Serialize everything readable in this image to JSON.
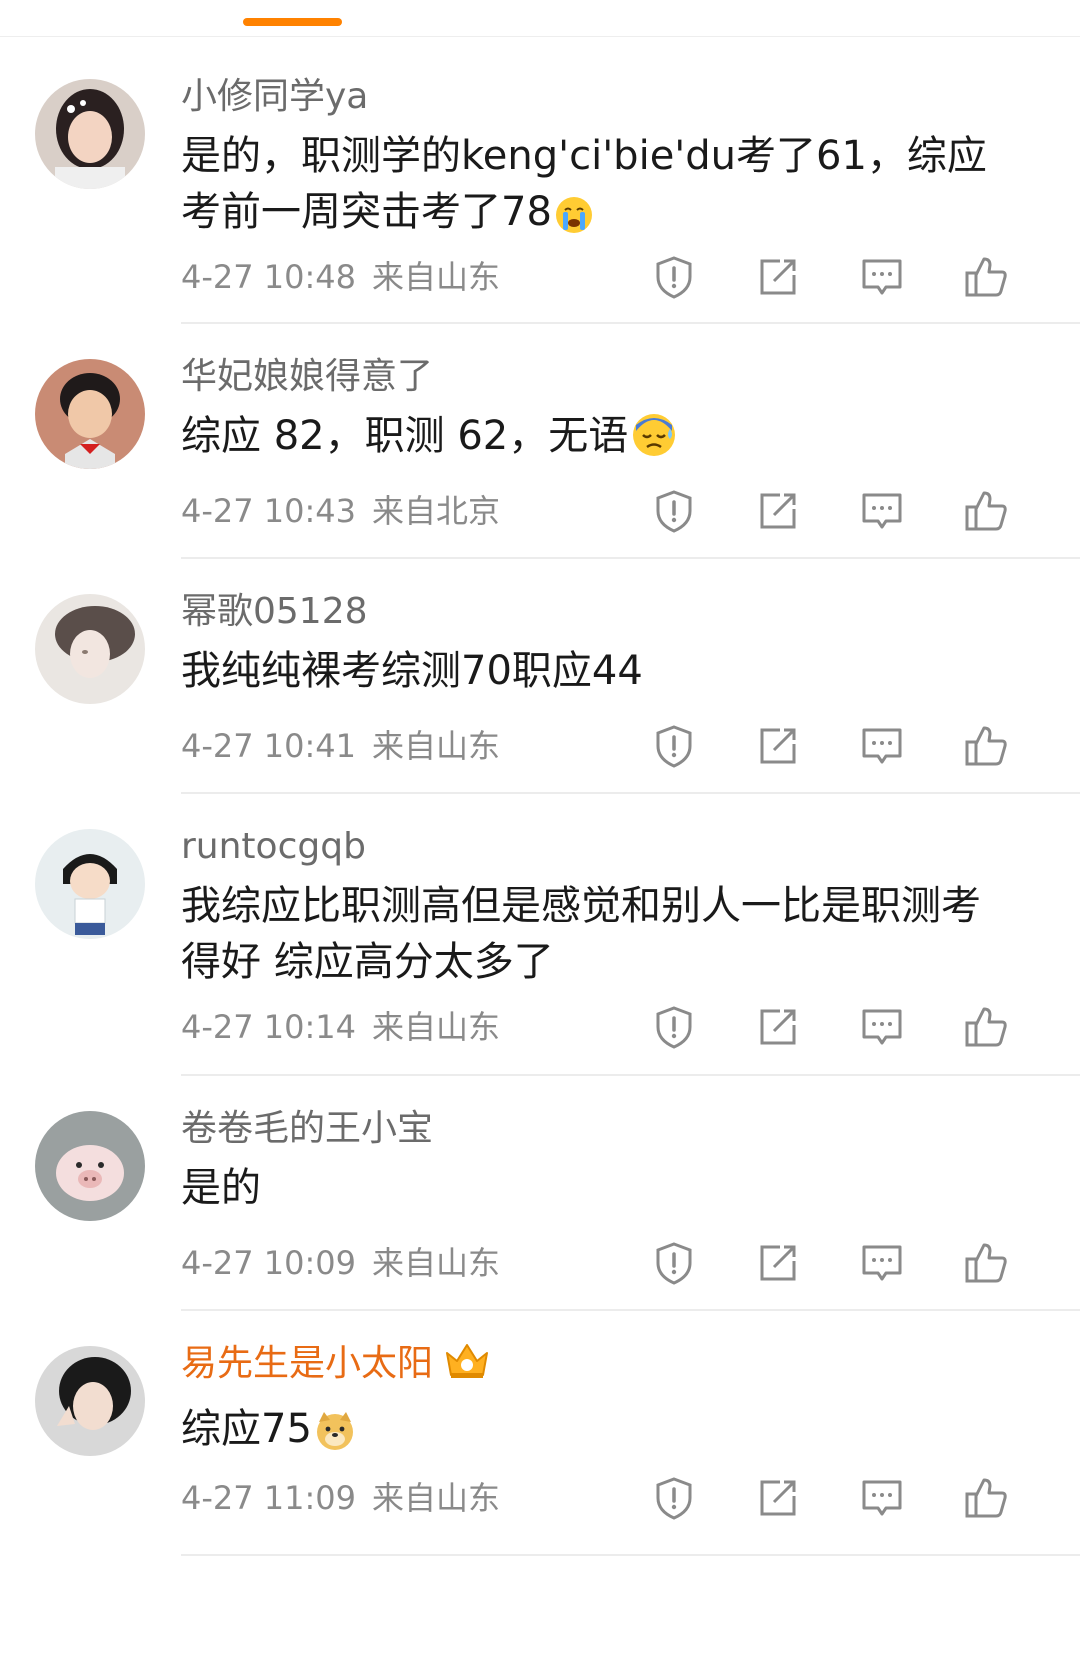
{
  "accent_color": "#ff8200",
  "vip_name_color": "#e86b14",
  "comments": [
    {
      "username": "小修同学ya",
      "text": "是的，职测学的keng'ci'bie'du考了61，综应考前一周突击考了78",
      "emoji": "crying-face",
      "time": "4-27 10:48",
      "location": "来自山东"
    },
    {
      "username": "华妃娘娘得意了",
      "text": "综应 82，职测 62，无语",
      "emoji": "anxious-sweat-face",
      "time": "4-27 10:43",
      "location": "来自北京"
    },
    {
      "username": "幂歌05128",
      "text": "我纯纯裸考综测70职应44",
      "time": "4-27 10:41",
      "location": "来自山东"
    },
    {
      "username": "runtocgqb",
      "text": "我综应比职测高但是感觉和别人一比是职测考得好 综应高分太多了",
      "time": "4-27 10:14",
      "location": "来自山东"
    },
    {
      "username": "卷卷毛的王小宝",
      "text": "是的",
      "time": "4-27 10:09",
      "location": "来自山东"
    },
    {
      "username": "易先生是小太阳",
      "badge": "crown-badge-icon",
      "text": "综应75",
      "emoji": "doge-face",
      "time": "4-27 11:09",
      "location": "来自山东"
    }
  ],
  "action_icons": [
    "report-icon",
    "share-icon",
    "reply-icon",
    "like-icon"
  ]
}
